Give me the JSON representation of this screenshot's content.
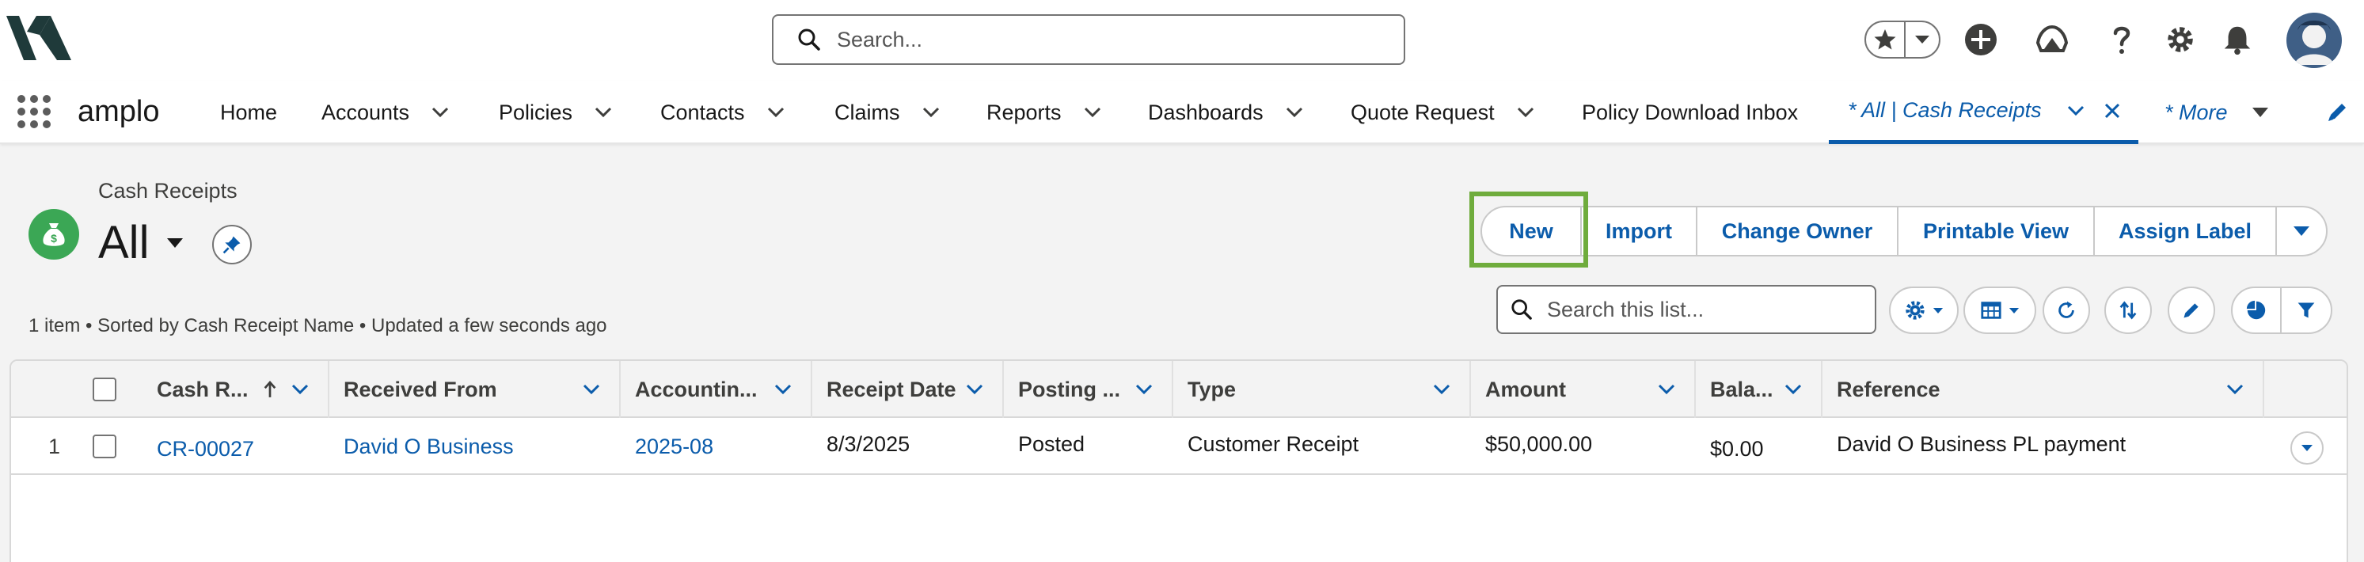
{
  "header": {
    "search_placeholder": "Search..."
  },
  "nav": {
    "app_name": "amplo",
    "items": [
      {
        "label": "Home"
      },
      {
        "label": "Accounts"
      },
      {
        "label": "Policies"
      },
      {
        "label": "Contacts"
      },
      {
        "label": "Claims"
      },
      {
        "label": "Reports"
      },
      {
        "label": "Dashboards"
      },
      {
        "label": "Quote Request"
      },
      {
        "label": "Policy Download Inbox"
      },
      {
        "label": "* All | Cash Receipts"
      },
      {
        "label": "* More"
      }
    ]
  },
  "listview": {
    "object_label": "Cash Receipts",
    "title": "All",
    "status": "1 item • Sorted by Cash Receipt Name • Updated a few seconds ago",
    "buttons": {
      "new": "New",
      "import": "Import",
      "change_owner": "Change Owner",
      "printable_view": "Printable View",
      "assign_label": "Assign Label"
    },
    "search_placeholder": "Search this list..."
  },
  "table": {
    "columns": [
      {
        "label": "Cash R..."
      },
      {
        "label": "Received From"
      },
      {
        "label": "Accountin..."
      },
      {
        "label": "Receipt Date"
      },
      {
        "label": "Posting ..."
      },
      {
        "label": "Type"
      },
      {
        "label": "Amount"
      },
      {
        "label": "Bala..."
      },
      {
        "label": "Reference"
      }
    ],
    "rows": [
      {
        "num": "1",
        "name": "CR-00027",
        "received_from": "David O Business",
        "accounting_period": "2025-08",
        "receipt_date": "8/3/2025",
        "posting_status": "Posted",
        "type": "Customer Receipt",
        "amount": "$50,000.00",
        "balance": "$0.00",
        "reference": "David O Business PL payment"
      }
    ]
  },
  "colors": {
    "brand_blue": "#0b5cab",
    "object_icon_green": "#3ba755",
    "highlight_green": "#6fac3c"
  },
  "icons": [
    "logo-icon",
    "search-icon",
    "star-icon",
    "add-icon",
    "trailhead-icon",
    "help-icon",
    "gear-icon",
    "bell-icon",
    "avatar",
    "app-launcher-icon",
    "money-bag-icon",
    "pin-icon",
    "refresh-icon",
    "sort-icon",
    "pencil-icon",
    "chart-icon",
    "filter-icon"
  ]
}
